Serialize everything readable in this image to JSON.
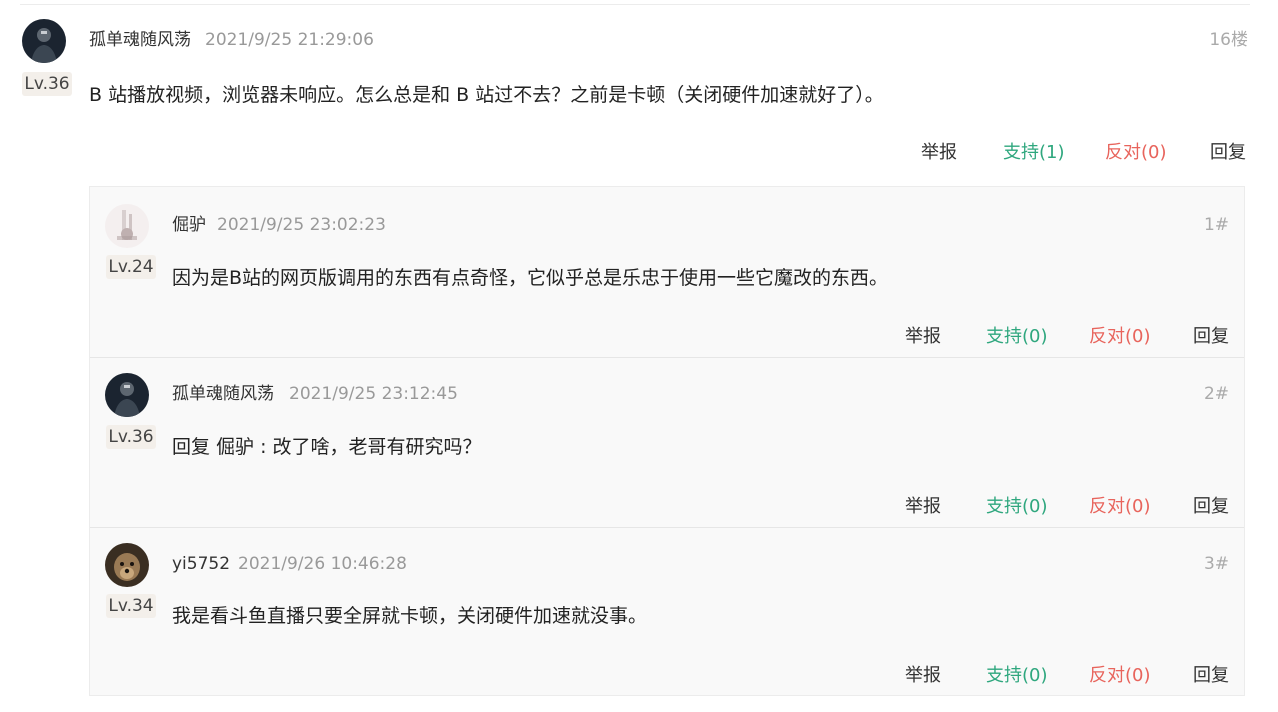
{
  "main_post": {
    "username": "孤单魂随风荡",
    "timestamp": "2021/9/25 21:29:06",
    "floor": "16楼",
    "level": "Lv.36",
    "content": "B 站播放视频，浏览器未响应。怎么总是和 B 站过不去？之前是卡顿（关闭硬件加速就好了）。",
    "actions": {
      "report": "举报",
      "support": "支持(1)",
      "oppose": "反对(0)",
      "reply": "回复"
    }
  },
  "replies": [
    {
      "username": "倔驴",
      "timestamp": "2021/9/25 23:02:23",
      "floor": "1#",
      "level": "Lv.24",
      "content": "因为是B站的网页版调用的东西有点奇怪，它似乎总是乐忠于使用一些它魔改的东西。",
      "actions": {
        "report": "举报",
        "support": "支持(0)",
        "oppose": "反对(0)",
        "reply": "回复"
      }
    },
    {
      "username": "孤单魂随风荡",
      "timestamp": "2021/9/25 23:12:45",
      "floor": "2#",
      "level": "Lv.36",
      "content": "回复 倔驴 : 改了啥，老哥有研究吗？",
      "actions": {
        "report": "举报",
        "support": "支持(0)",
        "oppose": "反对(0)",
        "reply": "回复"
      }
    },
    {
      "username": "yi5752",
      "timestamp": "2021/9/26 10:46:28",
      "floor": "3#",
      "level": "Lv.34",
      "content": "我是看斗鱼直播只要全屏就卡顿，关闭硬件加速就没事。",
      "actions": {
        "report": "举报",
        "support": "支持(0)",
        "oppose": "反对(0)",
        "reply": "回复"
      }
    }
  ],
  "colors": {
    "support": "#2fa77e",
    "oppose": "#e8645c",
    "meta": "#999999"
  }
}
